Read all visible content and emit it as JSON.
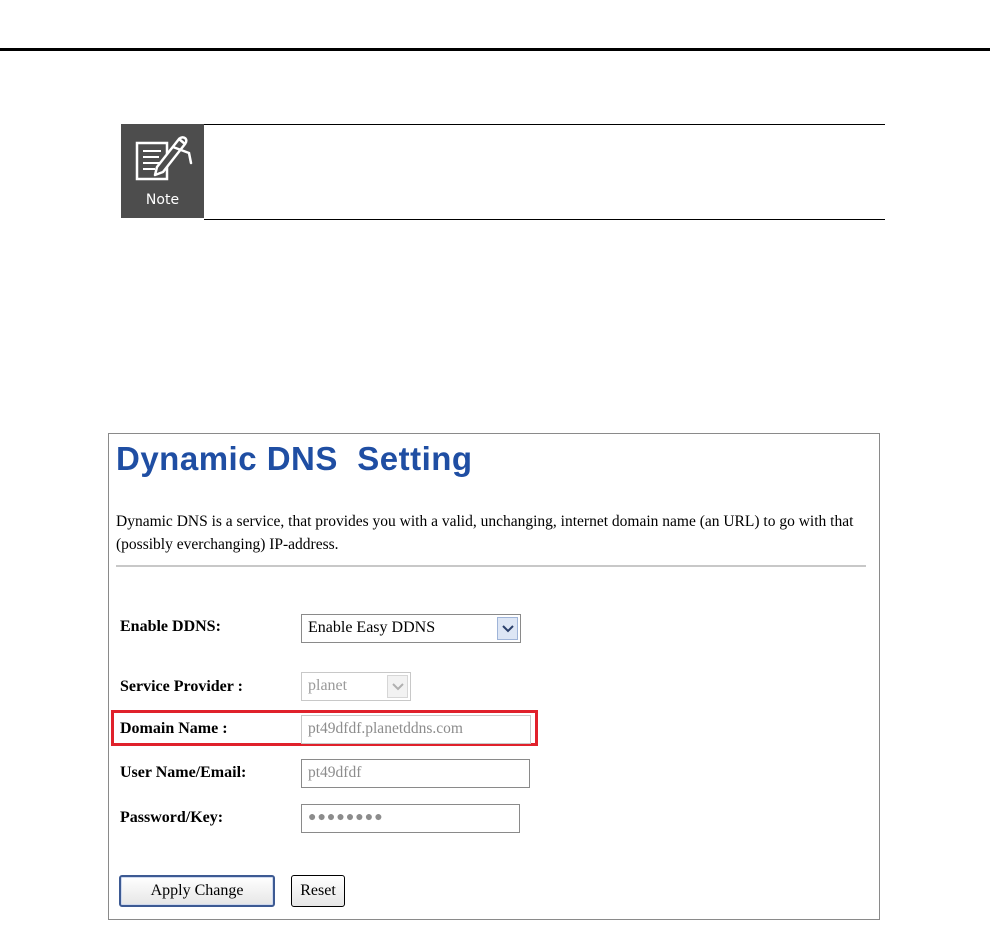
{
  "note": {
    "icon_name": "note-pencil-icon",
    "label": "Note"
  },
  "panel": {
    "title": "Dynamic DNS  Setting",
    "description": "Dynamic DNS is a service, that provides you with a valid, unchanging, internet domain name (an URL) to go with that (possibly everchanging) IP-address.",
    "accent_color": "#1f4ea3",
    "highlight_color": "#e0212b"
  },
  "form": {
    "enable_ddns": {
      "label": "Enable DDNS:",
      "value": "Enable Easy DDNS"
    },
    "service_provider": {
      "label": "Service Provider :",
      "value": "planet",
      "disabled": true
    },
    "domain_name": {
      "label": "Domain Name :",
      "value": "pt49dfdf.planetddns.com",
      "disabled": true,
      "highlighted": true
    },
    "user_name": {
      "label": "User Name/Email:",
      "value": "pt49dfdf"
    },
    "password": {
      "label": "Password/Key:",
      "value": "●●●●●●●●"
    }
  },
  "buttons": {
    "apply": "Apply Change",
    "reset": "Reset"
  }
}
